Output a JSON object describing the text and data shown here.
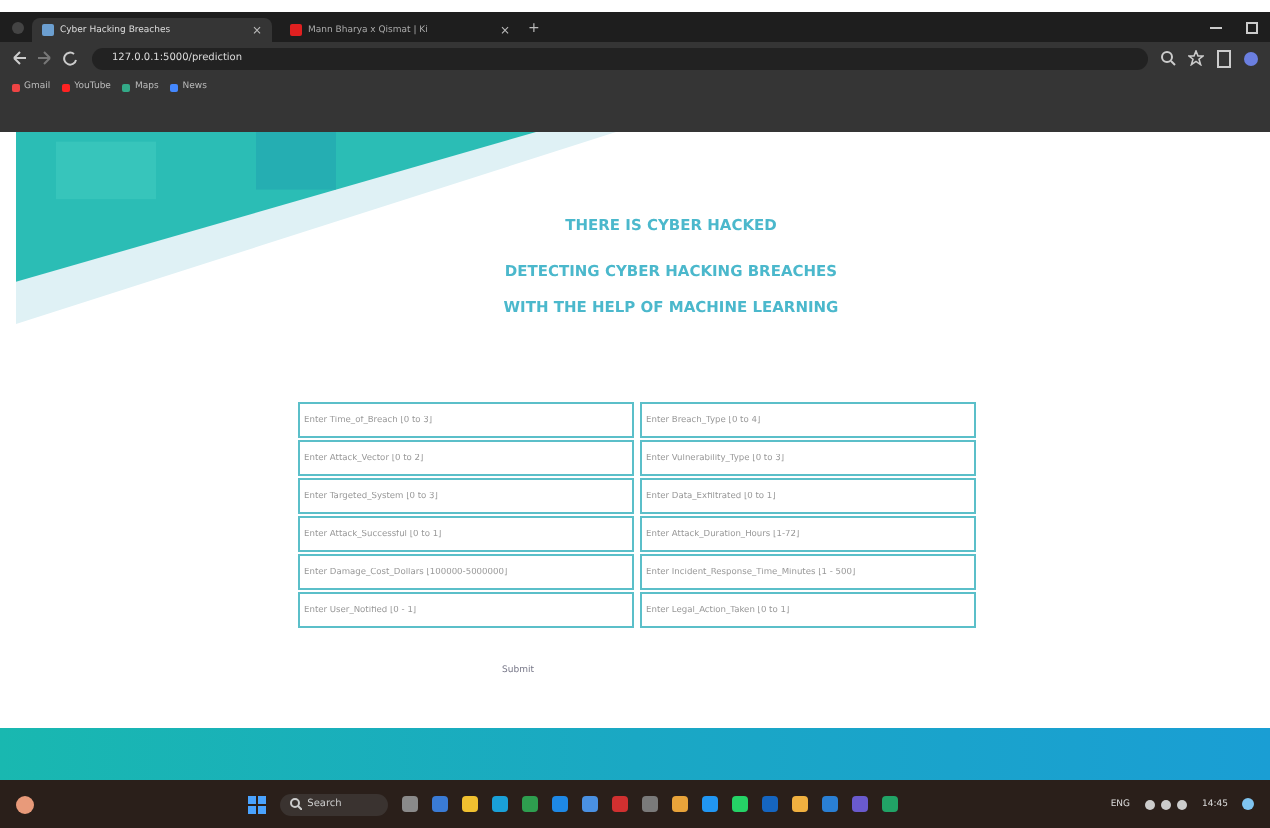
{
  "browser": {
    "tabs": [
      {
        "title": "Cyber Hacking Breaches",
        "selected": true,
        "close": "×"
      },
      {
        "title": "Mann Bharya x Qismat | Ki",
        "selected": false,
        "close": "×"
      }
    ],
    "new_tab": "+",
    "url": "127.0.0.1:5000/prediction",
    "bookmarks": [
      "Gmail",
      "YouTube",
      "Maps",
      "News"
    ]
  },
  "page": {
    "headings": [
      "THERE IS CYBER HACKED",
      "DETECTING CYBER HACKING BREACHES",
      "WITH THE HELP OF MACHINE LEARNING"
    ],
    "fields": [
      {
        "placeholder": "Enter Time_of_Breach [0 to 3]"
      },
      {
        "placeholder": "Enter Breach_Type [0 to 4]"
      },
      {
        "placeholder": "Enter Attack_Vector [0 to 2]"
      },
      {
        "placeholder": "Enter Vulnerability_Type [0 to 3]"
      },
      {
        "placeholder": "Enter Targeted_System [0 to 3]"
      },
      {
        "placeholder": "Enter Data_Exfiltrated [0 to 1]"
      },
      {
        "placeholder": "Enter Attack_Successful [0 to 1]"
      },
      {
        "placeholder": "Enter Attack_Duration_Hours [1-72]"
      },
      {
        "placeholder": "Enter Damage_Cost_Dollars [100000-5000000]"
      },
      {
        "placeholder": "Enter Incident_Response_Time_Minutes [1 - 500]"
      },
      {
        "placeholder": "Enter User_Notified [0 - 1]"
      },
      {
        "placeholder": "Enter Legal_Action_Taken [0 to 1]"
      }
    ],
    "submit": "Submit"
  },
  "taskbar": {
    "search": "Search",
    "language": "ENG",
    "time": "14:45"
  }
}
